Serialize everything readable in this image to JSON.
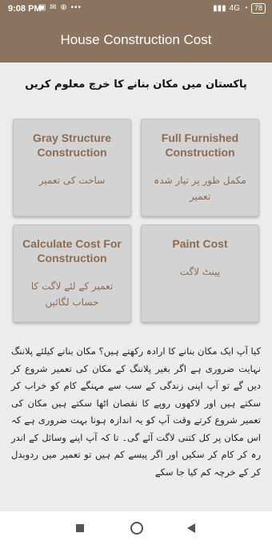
{
  "status": {
    "time": "9:08 PM",
    "left_icons": "▣ ✉ ⊕ •••",
    "network": "4G",
    "battery": "78"
  },
  "appbar": {
    "title": "House Construction Cost"
  },
  "main": {
    "heading": "پاکستان میں مکان بنانے کا خرچ معلوم کریں",
    "cards": [
      {
        "title": "Gray Structure Construction",
        "subtitle": "ساخت کی تعمیر"
      },
      {
        "title": "Full Furnished Construction",
        "subtitle": "مکمل طور پر تیار شدہ تعمیر"
      },
      {
        "title": "Calculate Cost For Construction",
        "subtitle": "تعمیر کے لئے لاگت کا حساب لگائیں"
      },
      {
        "title": "Paint Cost",
        "subtitle": "پینٹ لاگت"
      }
    ],
    "paragraph": "کیا آپ ایک مکان بنانے کا ارادہ رکھتے ہیں؟ مکان بنانے کیلئے پلاننگ نہایت ضروری ہے اگر بغیر پلاننگ کے مکان کی تعمیر شروع کر دیں گے تو آپ اپنی زندگی کے سب سے مہنگے کام کو خراب کر سکتے ہیں اور لاکھوں روپے کا نقصان اٹھا سکتے ہیں مکان کی تعمیر شروع کرتے وقت آپ کو یہ اندازہ ہونا بہت ضروری ہے کہ اس مکان پر کل کتنی لاگت آئے گی۔ تا کہ آپ اپنے وسائل کے اندر رہ کر کام کر سکیں اور اگر پیسے کم ہیں تو تعمیر میں ردوبدل کر کے خرچہ کم کیا جا سکے"
  },
  "navbar": {
    "icons": [
      "recents-icon",
      "home-icon",
      "back-icon"
    ]
  }
}
